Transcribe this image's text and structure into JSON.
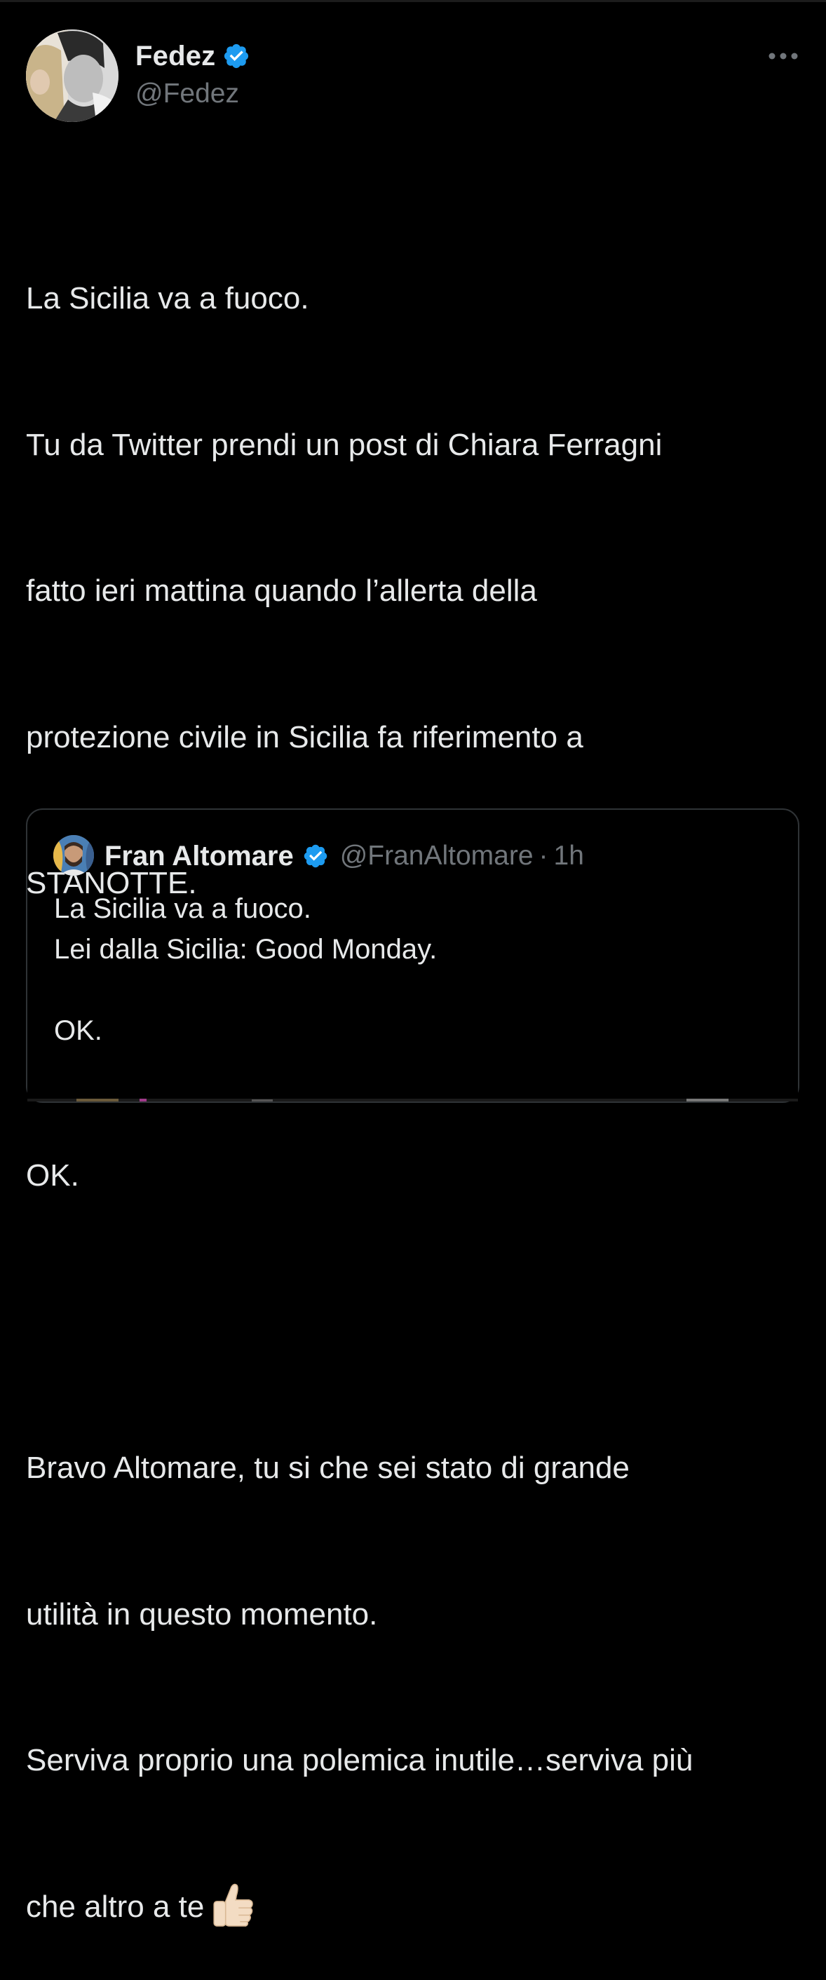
{
  "tweet": {
    "author": {
      "name": "Fedez",
      "handle": "@Fedez",
      "verified": true,
      "verified_color": "#1d9bf0"
    },
    "menu_icon": "more-horizontal-icon",
    "text_lines": [
      "La Sicilia va a fuoco.",
      "Tu da Twitter prendi un post di Chiara Ferragni",
      "fatto ieri mattina quando l’allerta della",
      "protezione civile in Sicilia fa riferimento a",
      "STANOTTE.",
      "",
      "OK.",
      "",
      "Bravo Altomare, tu si che sei stato di grande",
      "utilità in questo momento.",
      "Serviva proprio una polemica inutile…serviva più",
      "che altro a te"
    ],
    "trailing_emoji": "thumbs-up-emoji"
  },
  "quoted_tweet": {
    "author": {
      "name": "Fran Altomare",
      "handle": "@FranAltomare",
      "verified": true
    },
    "separator": "·",
    "time": "1h",
    "text_lines": [
      "La Sicilia va a fuoco.",
      "Lei dalla Sicilia: Good Monday.",
      "",
      "OK."
    ]
  },
  "colors": {
    "background": "#000000",
    "text_primary": "#e7e9ea",
    "text_secondary": "#71767b",
    "border": "#2f3336",
    "accent": "#1d9bf0"
  }
}
